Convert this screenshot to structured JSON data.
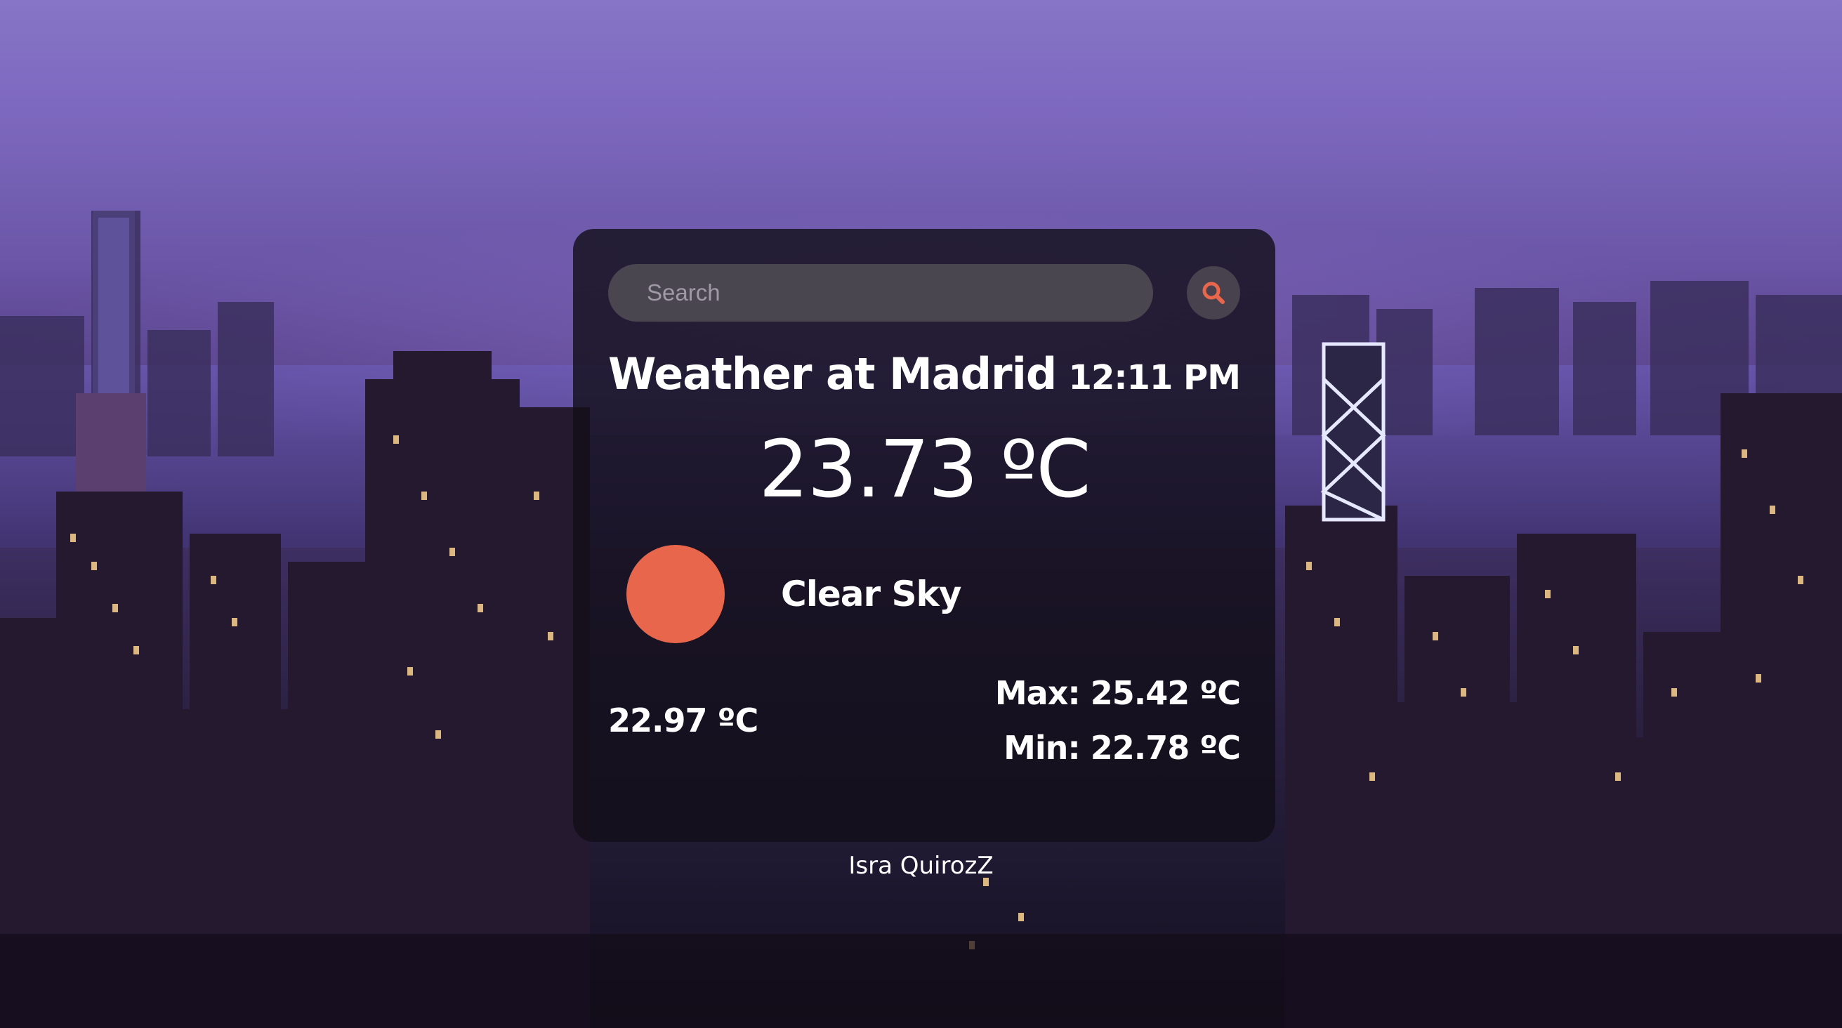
{
  "search": {
    "placeholder": "Search",
    "value": "",
    "button_icon": "search-icon"
  },
  "weather": {
    "title": "Weather at Madrid",
    "time": "12:11 PM",
    "temperature": "23.73 ºC",
    "condition": "Clear Sky",
    "condition_icon": "sun-icon",
    "feels_like": "22.97 ºC",
    "max": "Max: 25.42 ºC",
    "min": "Min: 22.78 ºC"
  },
  "footer": {
    "credit": "Isra QuirozZ"
  },
  "colors": {
    "sun": "#e8664b",
    "search_icon": "#e8664b",
    "card_bg": "rgba(18,14,24,0.80)"
  }
}
